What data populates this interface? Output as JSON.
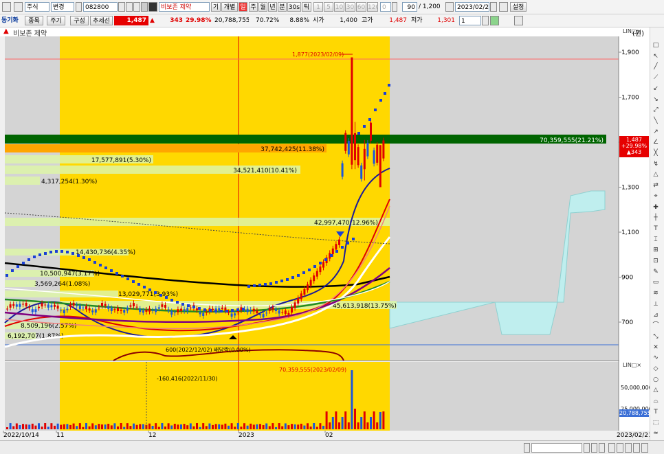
{
  "toolbar": {
    "type_select": "주식",
    "change_select": "변경",
    "code": "082800",
    "stock_name": "비보존 제약",
    "tab_individual": "개별",
    "tab_day": "일",
    "tab_week": "주",
    "tab_month": "월",
    "tab_year": "년",
    "tab_minute": "분",
    "tab_30s": "30s",
    "tab_tick": "틱",
    "minute_options": [
      "1",
      "5",
      "10",
      "30",
      "60",
      "120"
    ],
    "num_value": "0",
    "count_value": "90",
    "total_value": "/ 1,200",
    "date_value": "2023/02/21",
    "settings_label": "설정"
  },
  "infobar": {
    "sync_label": "동기화",
    "item_button": "종목",
    "period_button": "주기",
    "compose_button": "구성",
    "trend_button": "추세선",
    "price": "1,487",
    "change": "343",
    "change_pct": "29.98%",
    "volume": "20,788,755",
    "rate1": "70.72%",
    "rate2": "8.88%",
    "open_label": "시가",
    "open": "1,400",
    "high_label": "고가",
    "high": "1,487",
    "low_label": "저가",
    "low": "1,301",
    "page_value": "1"
  },
  "chart": {
    "title": "비보존 제약",
    "unit_label": "(원)",
    "y_ticks": [
      "1,900",
      "1,700",
      "1,500",
      "1,300",
      "1,100",
      "900",
      "700"
    ],
    "price_box": {
      "price": "1,487",
      "pct": "+29.98%",
      "change": "▲343"
    },
    "volume_ticks": [
      "50,000,000",
      "25,000,000"
    ],
    "volume_box": "20,788,755",
    "high_annotation": "1,877(2023/02/09)",
    "vol_annotation": "70,359,555(2023/02/09)",
    "low_annotation": "-160,416(2022/11/30)",
    "dividend_annotation": "배당락(0.00%)",
    "low_price_annotation": "600(2022/12/02)",
    "profile_labels": [
      {
        "text": "70,359,555(21.21%)",
        "bar": "green"
      },
      {
        "text": "37,742,425(11.38%)",
        "bar": "orange"
      },
      {
        "text": "17,577,891(5.30%)",
        "bar": "light"
      },
      {
        "text": "34,521,410(10.41%)",
        "bar": "light"
      },
      {
        "text": "4,317,254(1.30%)",
        "bar": "light"
      },
      {
        "text": "42,997,470(12.96%)",
        "bar": "light"
      },
      {
        "text": "14,430,736(4.35%)",
        "bar": "light"
      },
      {
        "text": "10,500,947(3.17%)",
        "bar": "light"
      },
      {
        "text": "3,569,264(1.08%)",
        "bar": "light"
      },
      {
        "text": "13,029,771(3.93%)",
        "bar": "light"
      },
      {
        "text": "45,613,918(13.75%)",
        "bar": "light"
      },
      {
        "text": "8,509,196(2.57%)",
        "bar": "light"
      },
      {
        "text": "6,192,707(1.87%)",
        "bar": "light"
      }
    ],
    "x_labels": [
      "2022/10/14",
      "11",
      "12",
      "2023",
      "02"
    ],
    "end_date": "2023/02/21"
  },
  "side_tools": [
    "pointer",
    "cross",
    "hline",
    "vline",
    "trend",
    "ray",
    "channel",
    "fibo",
    "pencil",
    "text",
    "rect",
    "ellipse",
    "triangle",
    "arc",
    "delete"
  ],
  "colors": {
    "highlight": "#ffd700",
    "rise": "#e00000",
    "fall": "#1a56db",
    "volume_profile": "#ccffaa",
    "dominant_band": "#006400"
  }
}
